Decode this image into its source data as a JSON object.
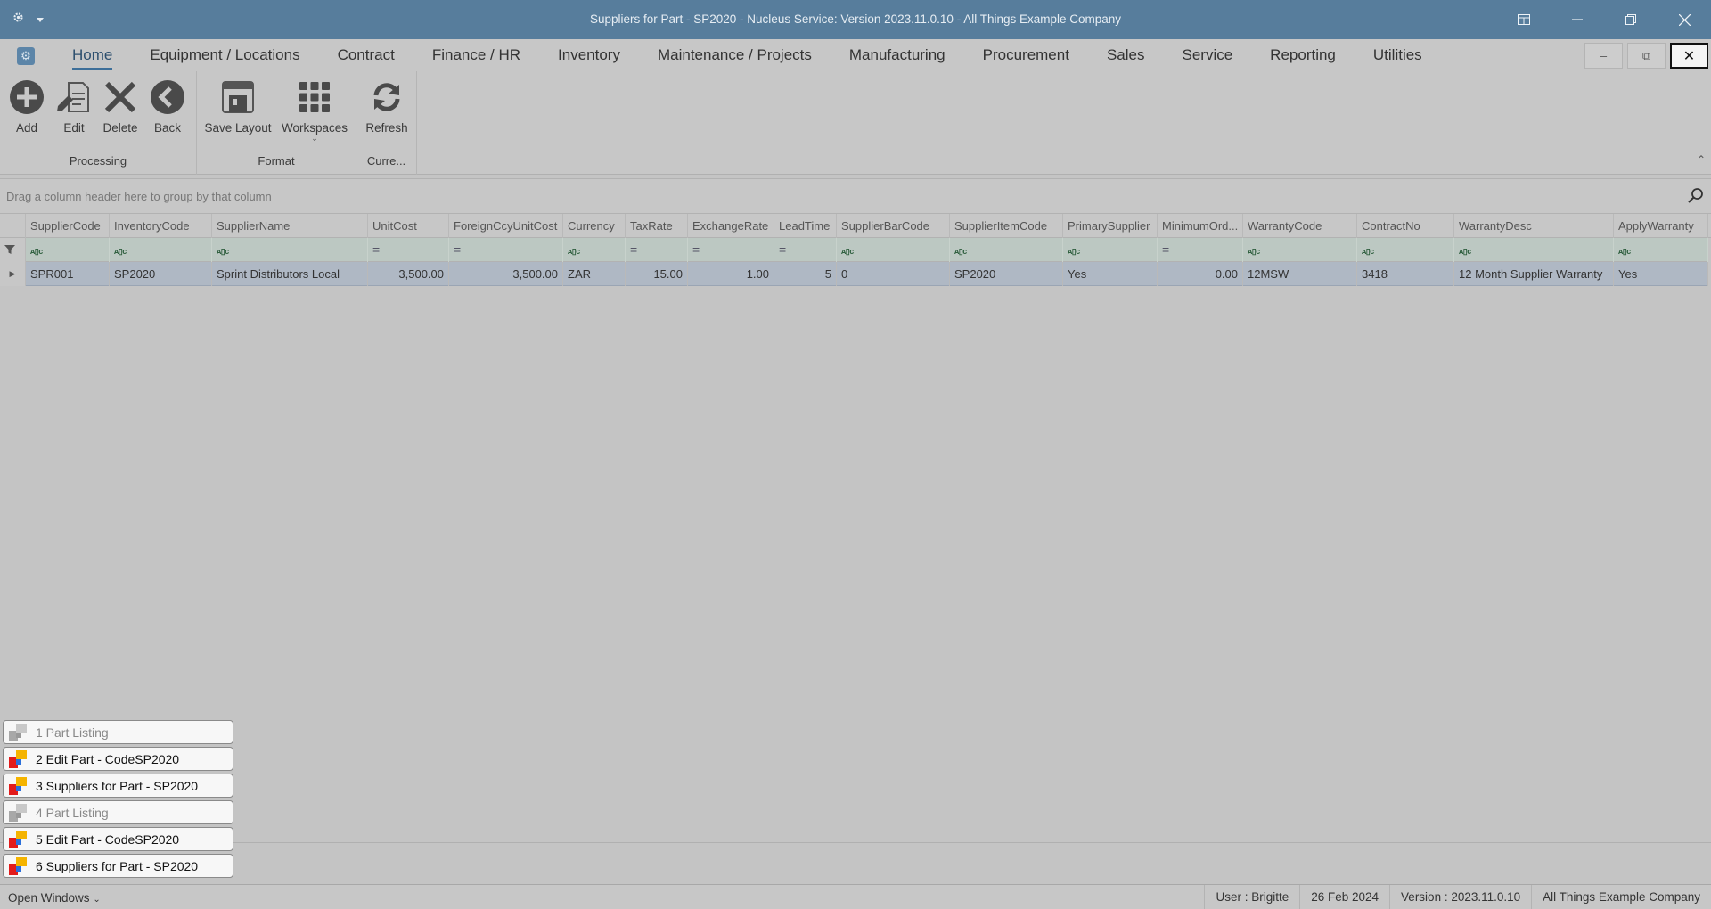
{
  "window": {
    "title": "Suppliers for Part - SP2020 - Nucleus Service: Version 2023.11.0.10 - All Things Example Company"
  },
  "menu": {
    "tabs": [
      "Home",
      "Equipment / Locations",
      "Contract",
      "Finance / HR",
      "Inventory",
      "Maintenance / Projects",
      "Manufacturing",
      "Procurement",
      "Sales",
      "Service",
      "Reporting",
      "Utilities"
    ],
    "active": "Home"
  },
  "ribbon": {
    "groups": {
      "processing": "Processing",
      "format": "Format",
      "current": "Curre..."
    },
    "buttons": {
      "add": "Add",
      "edit": "Edit",
      "delete": "Delete",
      "back": "Back",
      "save_layout": "Save Layout",
      "workspaces": "Workspaces",
      "refresh": "Refresh"
    }
  },
  "grid": {
    "group_hint": "Drag a column header here to group by that column",
    "columns": [
      "SupplierCode",
      "InventoryCode",
      "SupplierName",
      "UnitCost",
      "ForeignCcyUnitCost",
      "Currency",
      "TaxRate",
      "ExchangeRate",
      "LeadTime",
      "SupplierBarCode",
      "SupplierItemCode",
      "PrimarySupplier",
      "MinimumOrd...",
      "WarrantyCode",
      "ContractNo",
      "WarrantyDesc",
      "ApplyWarranty"
    ],
    "filter_icons": [
      "abc",
      "abc",
      "abc",
      "=",
      "=",
      "abc",
      "=",
      "=",
      "=",
      "abc",
      "abc",
      "abc",
      "=",
      "abc",
      "abc",
      "abc",
      "abc"
    ],
    "rows": [
      [
        "SPR001",
        "SP2020",
        "Sprint Distributors Local",
        "3,500.00",
        "3,500.00",
        "ZAR",
        "15.00",
        "1.00",
        "5",
        "0",
        "SP2020",
        "Yes",
        "0.00",
        "12MSW",
        "3418",
        "12 Month Supplier Warranty",
        "Yes"
      ]
    ]
  },
  "open_windows": {
    "items": [
      {
        "label": "1 Part Listing",
        "active": false
      },
      {
        "label": "2 Edit Part - CodeSP2020",
        "active": true
      },
      {
        "label": "3 Suppliers for Part - SP2020",
        "active": true
      },
      {
        "label": "4 Part Listing",
        "active": false
      },
      {
        "label": "5 Edit Part - CodeSP2020",
        "active": true
      },
      {
        "label": "6 Suppliers for Part - SP2020",
        "active": true
      }
    ]
  },
  "status": {
    "open_windows": "Open Windows",
    "user": "User : Brigitte",
    "date": "26 Feb 2024",
    "version": "Version : 2023.11.0.10",
    "company": "All Things Example Company"
  }
}
